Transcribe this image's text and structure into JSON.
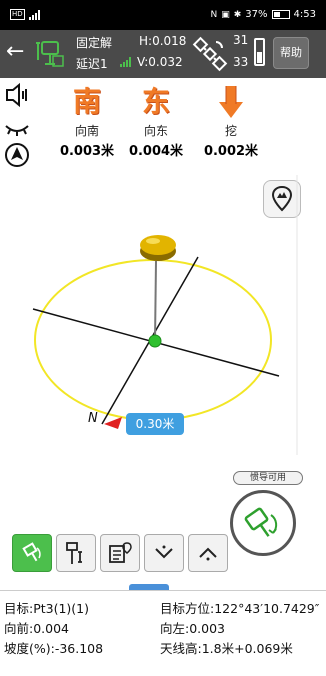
{
  "status_bar": {
    "left_icons": [
      "hd-icon",
      "signal-4g-icon"
    ],
    "left_text": "HD",
    "battery_pct": "37%",
    "time": "4:53",
    "right_icons": [
      "nfc-icon",
      "vibrate-icon",
      "bluetooth-icon",
      "battery-icon"
    ]
  },
  "top_bar": {
    "fix_status": "固定解",
    "delay": "延迟1",
    "h_precision": "H:0.018",
    "v_precision": "V:0.032",
    "sat_used": "31",
    "sat_visible": "33",
    "help_label": "帮助"
  },
  "directions": [
    {
      "glyph": "南",
      "label": "向南",
      "value": "0.003米"
    },
    {
      "glyph": "东",
      "label": "向东",
      "value": "0.004米"
    },
    {
      "glyph": "挖",
      "label": "挖",
      "value": "0.002米"
    }
  ],
  "scene": {
    "distance_label": "0.30米",
    "north_label": "N"
  },
  "ins": {
    "label": "惯导可用"
  },
  "info": {
    "target": "目标:Pt3(1)(1)",
    "target_bearing": "目标方位:122°43′10.7429″",
    "forward": "向前:0.004",
    "left": "向左:0.003",
    "slope": "坡度(%):-36.108",
    "antenna": "天线高:1.8米+0.069米"
  },
  "colors": {
    "accent_orange": "#f07a26",
    "ok_green": "#4cbf4c",
    "ellipse_yellow": "#f2e626",
    "distance_blue": "#3f9fe0",
    "topbar_gray": "#4a4a4a"
  }
}
